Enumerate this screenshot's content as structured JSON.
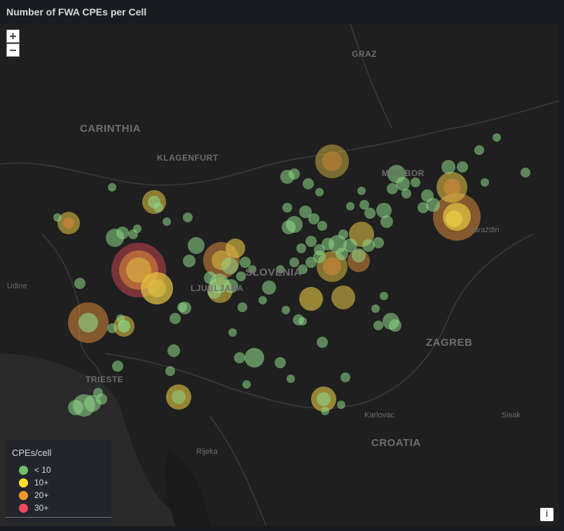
{
  "panel": {
    "title": "Number of FWA CPEs per Cell"
  },
  "map": {
    "zoom_in_label": "+",
    "zoom_out_label": "−",
    "info_label": "i",
    "places": {
      "graz": "GRAZ",
      "carinthia": "CARINTHIA",
      "klagenfurt": "KLAGENFURT",
      "maribor": "MARIBOR",
      "varazdin": "Varaždin",
      "udine": "Udine",
      "ljubljana": "LJUBLJANA",
      "slovenia": "SLOVENIA",
      "zagreb": "ZAGREB",
      "trieste": "TRIESTE",
      "karlovac": "Karlovac",
      "sisak": "Sisak",
      "croatia": "CROATIA",
      "rijeka": "Rijeka"
    }
  },
  "legend": {
    "title": "CPEs/cell",
    "items": [
      {
        "label": "< 10",
        "color": "#73bf69"
      },
      {
        "label": "10+",
        "color": "#fade2a"
      },
      {
        "label": "20+",
        "color": "#ff9830"
      },
      {
        "label": "30+",
        "color": "#f2495c"
      }
    ]
  }
}
